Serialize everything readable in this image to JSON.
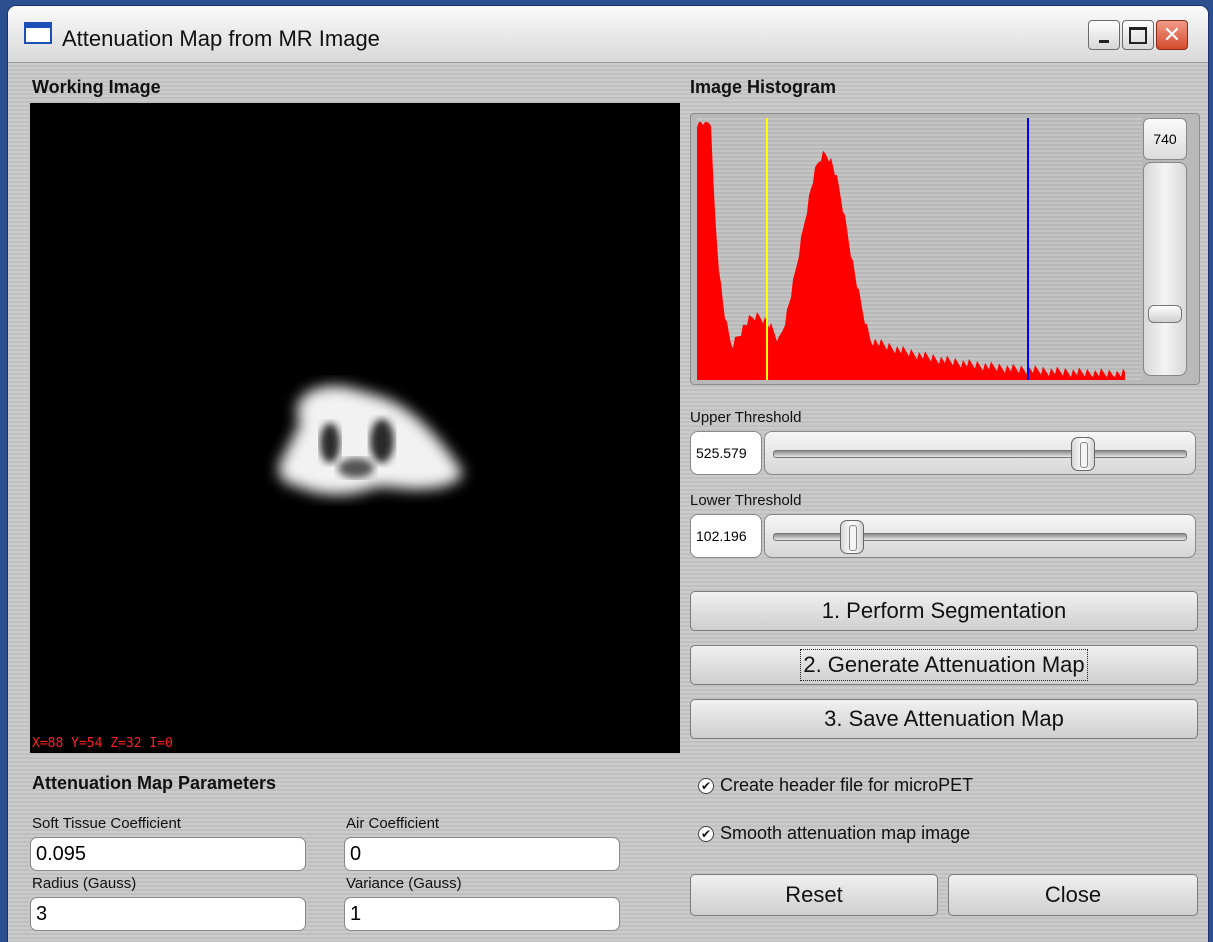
{
  "window": {
    "title": "Attenuation Map from MR Image",
    "controls": [
      "minimize",
      "maximize",
      "close"
    ]
  },
  "working_image": {
    "label": "Working Image",
    "coords": "X=88 Y=54 Z=32 I=0"
  },
  "histogram": {
    "label": "Image Histogram",
    "max_value": "740",
    "bar_color": "#ff0000",
    "upper_marker_color": "#0000ff",
    "lower_marker_color": "#ffff00",
    "vertical_scale_level": 0.74
  },
  "upper_threshold": {
    "label": "Upper Threshold",
    "value": "525.579",
    "level": 0.76
  },
  "lower_threshold": {
    "label": "Lower Threshold",
    "value": "102.196",
    "level": 0.17
  },
  "buttons": {
    "segment": "1. Perform Segmentation",
    "generate": "2. Generate Attenuation Map",
    "save": "3. Save Attenuation Map",
    "reset": "Reset",
    "close": "Close"
  },
  "options": {
    "header": {
      "label": "Create header file for microPET",
      "checked": true
    },
    "smooth": {
      "label": "Smooth attenuation map image",
      "checked": true
    }
  },
  "params": {
    "title": "Attenuation Map Parameters",
    "soft_tissue": {
      "label": "Soft Tissue Coefficient",
      "value": "0.095"
    },
    "air": {
      "label": "Air Coefficient",
      "value": "0"
    },
    "radius": {
      "label": "Radius (Gauss)",
      "value": "3"
    },
    "variance": {
      "label": "Variance (Gauss)",
      "value": "1"
    }
  }
}
